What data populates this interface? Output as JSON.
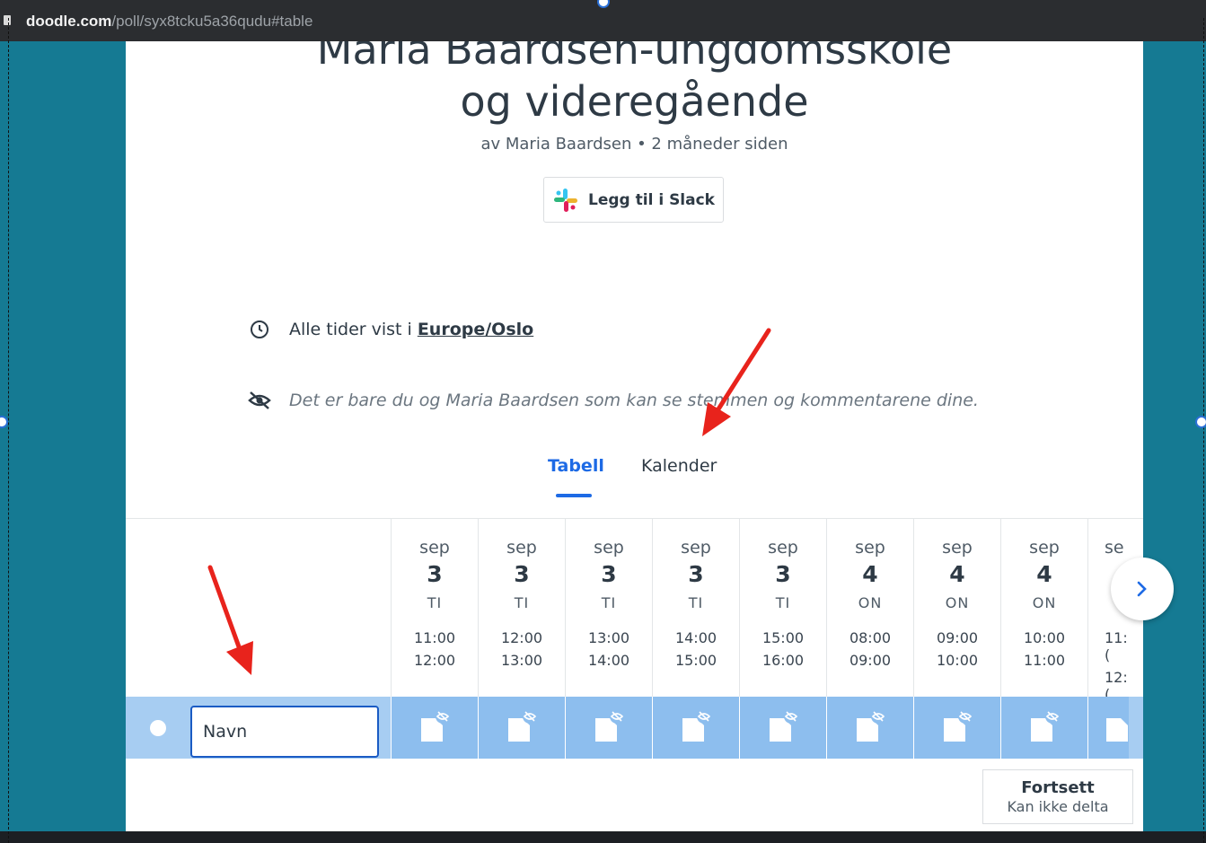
{
  "browser": {
    "url_host": "doodle.com",
    "url_path": "/poll/syx8tcku5a36qudu#table"
  },
  "poll": {
    "title_line1": "Maria Baardsen-ungdomsskole",
    "title_line2": "og videregående",
    "subtitle": "av Maria Baardsen • 2 måneder siden",
    "slack_label": "Legg til i Slack",
    "timezone_prefix": "Alle tider vist i",
    "timezone_link": "Europe/Oslo",
    "privacy_note": "Det er bare du og Maria Baardsen som kan se stemmen og kommentarene dine."
  },
  "tabs": {
    "table": "Tabell",
    "calendar": "Kalender"
  },
  "slots": [
    {
      "month": "sep",
      "day": "3",
      "weekday": "TI",
      "start": "11:00",
      "end": "12:00"
    },
    {
      "month": "sep",
      "day": "3",
      "weekday": "TI",
      "start": "12:00",
      "end": "13:00"
    },
    {
      "month": "sep",
      "day": "3",
      "weekday": "TI",
      "start": "13:00",
      "end": "14:00"
    },
    {
      "month": "sep",
      "day": "3",
      "weekday": "TI",
      "start": "14:00",
      "end": "15:00"
    },
    {
      "month": "sep",
      "day": "3",
      "weekday": "TI",
      "start": "15:00",
      "end": "16:00"
    },
    {
      "month": "sep",
      "day": "4",
      "weekday": "ON",
      "start": "08:00",
      "end": "09:00"
    },
    {
      "month": "sep",
      "day": "4",
      "weekday": "ON",
      "start": "09:00",
      "end": "10:00"
    },
    {
      "month": "sep",
      "day": "4",
      "weekday": "ON",
      "start": "10:00",
      "end": "11:00"
    },
    {
      "month": "se",
      "day": "",
      "weekday": "",
      "start": "11:(",
      "end": "12:("
    }
  ],
  "name_input": {
    "value": "Navn"
  },
  "footer": {
    "continue": "Fortsett",
    "cannot": "Kan ikke delta"
  },
  "colors": {
    "accent": "#1d6ae5",
    "vote_row": "#a7cdf2",
    "backdrop": "#157a93",
    "arrow": "#e8231c"
  }
}
